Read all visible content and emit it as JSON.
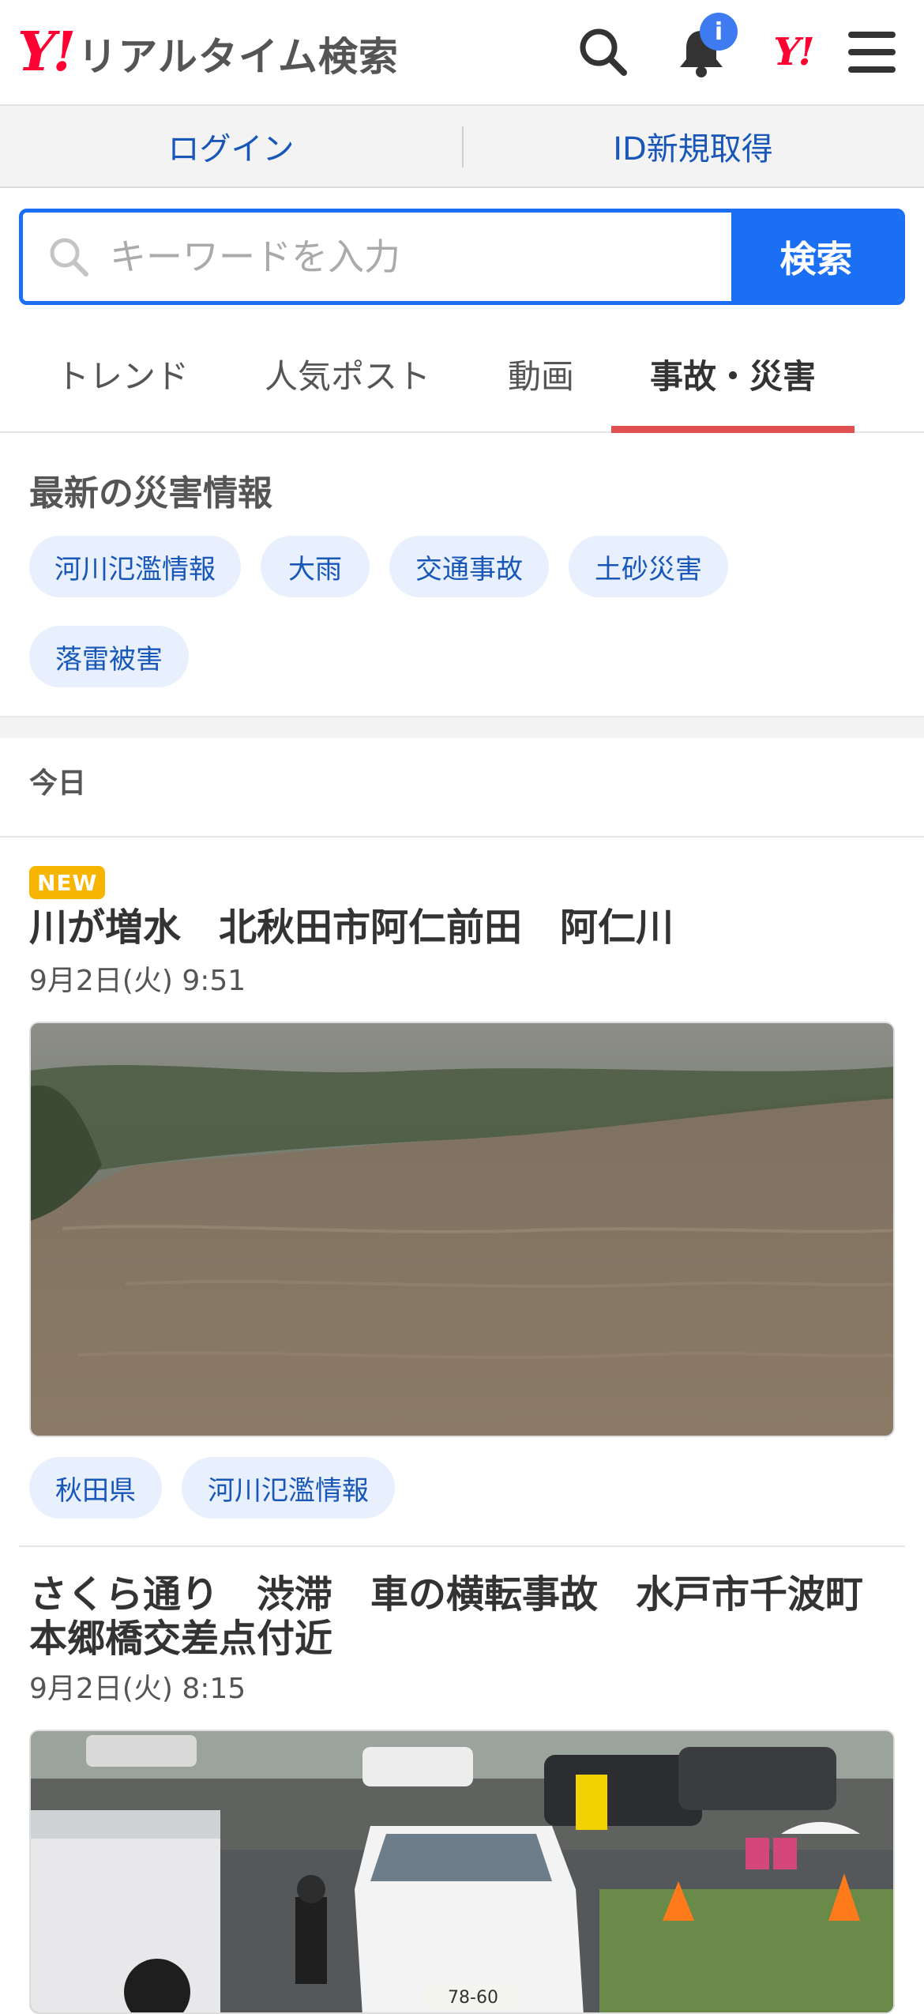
{
  "header": {
    "logo_y": "Y!",
    "logo_text": "リアルタイム検索",
    "notification_badge": "i",
    "yahoo_small": "Y!"
  },
  "login": {
    "login_label": "ログイン",
    "register_label": "ID新規取得"
  },
  "search": {
    "placeholder": "キーワードを入力",
    "button_label": "検索"
  },
  "tabs": [
    {
      "label": "トレンド"
    },
    {
      "label": "人気ポスト"
    },
    {
      "label": "動画"
    },
    {
      "label": "事故・災害",
      "active": true
    }
  ],
  "disaster_info": {
    "heading": "最新の災害情報",
    "chips": [
      "河川氾濫情報",
      "大雨",
      "交通事故",
      "土砂災害",
      "落雷被害"
    ]
  },
  "section_label": "今日",
  "articles": [
    {
      "badge": "NEW",
      "title": "川が増水　北秋田市阿仁前田　阿仁川",
      "date": "9月2日(火) 9:51",
      "tags": [
        "秋田県",
        "河川氾濫情報"
      ]
    },
    {
      "title_line1": "さくら通り　渋滞　車の横転事故　水戸市千波町",
      "title_line2": "本郷橋交差点付近",
      "date": "9月2日(火) 8:15",
      "plate_text": "78-60"
    }
  ],
  "colors": {
    "brand_red": "#ff0033",
    "accent_blue": "#1a6ff2",
    "link_blue": "#1856b8",
    "tab_underline": "#e05050",
    "new_badge": "#f7b500",
    "chip_bg": "#e7f0fc"
  }
}
